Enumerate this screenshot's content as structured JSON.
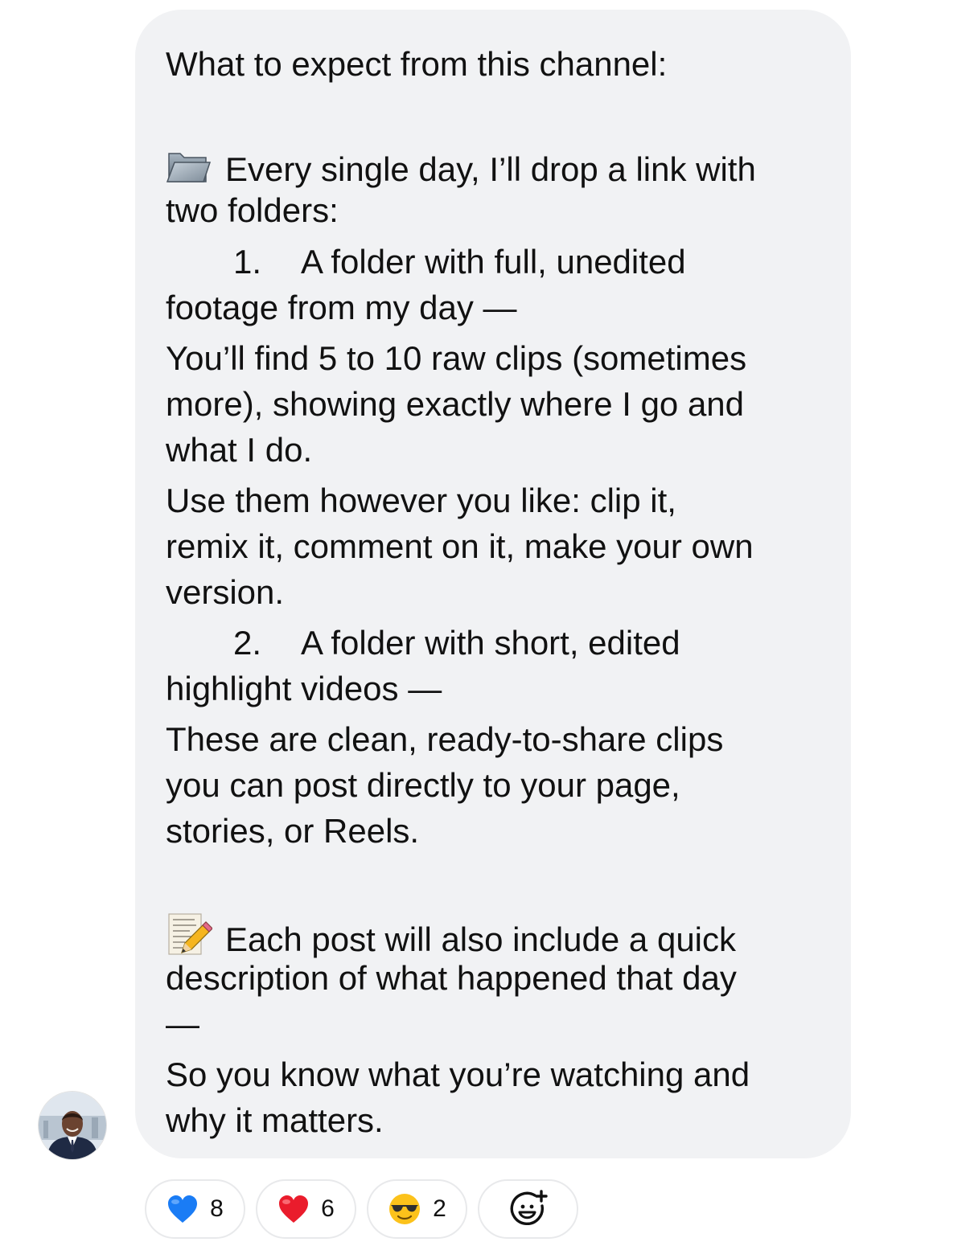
{
  "message": {
    "heading": "What to expect from this channel:",
    "section1": {
      "emoji_icon": "open-folder-icon",
      "line1": "Every single day, I’ll drop a link with",
      "line2": "two folders:"
    },
    "item1": {
      "number": "1.",
      "line1": "A folder with full, unedited",
      "line2": "footage from my day —"
    },
    "item1_desc": {
      "line1": "You’ll find 5 to 10 raw clips (sometimes",
      "line2": "more), showing exactly where I go and",
      "line3": "what I do."
    },
    "item1_use": {
      "line1": "Use them however you like: clip it,",
      "line2": "remix it, comment on it, make your own",
      "line3": "version."
    },
    "item2": {
      "number": "2.",
      "line1": "A folder with short, edited",
      "line2": "highlight videos —"
    },
    "item2_desc": {
      "line1": "These are clean, ready-to-share clips",
      "line2": "you can post directly to your page,",
      "line3": "stories, or Reels."
    },
    "section2": {
      "emoji_icon": "memo-pencil-icon",
      "line1": "Each post will also include a quick",
      "line2": "description of what happened that day",
      "line3": "—"
    },
    "closing": {
      "line1": "So you know what you’re watching and",
      "line2": "why it matters."
    }
  },
  "sender": {
    "avatar_icon": "person-in-suit-avatar"
  },
  "reactions": [
    {
      "icon": "blue-heart-icon",
      "count": "8"
    },
    {
      "icon": "red-heart-icon",
      "count": "6"
    },
    {
      "icon": "sunglasses-face-icon",
      "count": "2"
    },
    {
      "icon": "add-reaction-icon",
      "count": ""
    }
  ],
  "colors": {
    "bubble": "#f1f2f4",
    "text": "#111111",
    "blue_heart": "#1a7cf5",
    "red_heart": "#ea1c2c",
    "smiley": "#fcc21b"
  }
}
